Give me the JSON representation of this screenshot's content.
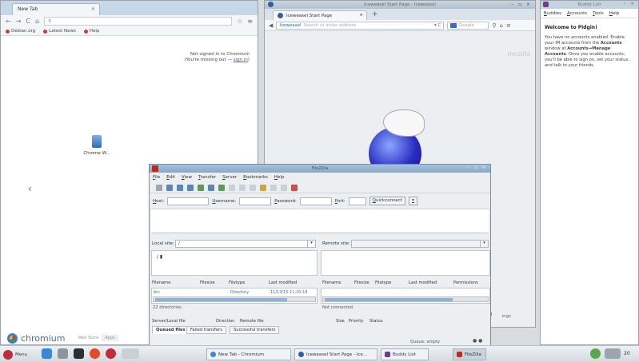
{
  "chromium": {
    "tab_title": "New Tab",
    "bookmarks": [
      "Debian.org",
      "Latest News",
      "Help"
    ],
    "signin_line1": "Not signed in to Chromium",
    "signin_line2": "(You're missing out — ",
    "signin_link": "sign in",
    "signin_line2_end": ")",
    "app_label": "Chrome W...",
    "brand": "chromium",
    "footer_mini1": "Web Store",
    "footer_mini2": "Apps"
  },
  "iceweasel": {
    "window_title": "Iceweasel Start Page - Iceweasel",
    "tab_title": "Iceweasel Start Page",
    "url_label": "Iceweasel",
    "url_placeholder": "Search or enter address",
    "search_placeholder": "Google",
    "watermark": "mozilla",
    "side_label": "ings"
  },
  "pidgin": {
    "window_title": "Buddy List",
    "menu": [
      "Buddies",
      "Accounts",
      "Tools",
      "Help"
    ],
    "heading": "Welcome to Pidgin!",
    "body_parts": [
      "You have no accounts enabled. Enable your IM accounts from the ",
      "Accounts",
      " window at ",
      "Accounts→Manage Accounts",
      ". Once you enable accounts, you'll be able to sign on, set your status, and talk to your friends."
    ]
  },
  "filezilla": {
    "window_title": "FileZilla",
    "menu": [
      "File",
      "Edit",
      "View",
      "Transfer",
      "Server",
      "Bookmarks",
      "Help"
    ],
    "quick": {
      "host_label": "Host:",
      "user_label": "Username:",
      "pass_label": "Password:",
      "port_label": "Port:",
      "connect_label": "Quickconnect"
    },
    "local_site_label": "Local site:",
    "local_site_value": "/",
    "remote_site_label": "Remote site:",
    "local_columns": [
      "Filename",
      "Filesize",
      "Filetype",
      "Last modified"
    ],
    "remote_columns": [
      "Filename",
      "Filesize",
      "Filetype",
      "Last modified",
      "Permissions"
    ],
    "local_rows": [
      {
        "name": "bin",
        "type": "Directory",
        "modified": "11/13/15 11:20:18"
      }
    ],
    "local_status": "22 directories",
    "remote_status": "Not connected.",
    "queue_columns": [
      "Server/Local file",
      "Direction",
      "Remote file",
      "Size",
      "Priority",
      "Status"
    ],
    "queue_tabs": [
      "Queued files",
      "Failed transfers",
      "Successful transfers"
    ],
    "queue_status": "Queue: empty"
  },
  "taskbar": {
    "menu_label": "Menu",
    "tasks": [
      {
        "label": "New Tab - Chromium"
      },
      {
        "label": "Iceweasel Start Page - Ice..."
      },
      {
        "label": "Buddy List"
      },
      {
        "label": "FileZilla"
      }
    ],
    "tray_text": "20"
  },
  "colors": {
    "chromium_tabbar": "#c5d7e8",
    "filezilla_titlebar": "#87a8c8",
    "link_blue": "#2a6ad0"
  }
}
